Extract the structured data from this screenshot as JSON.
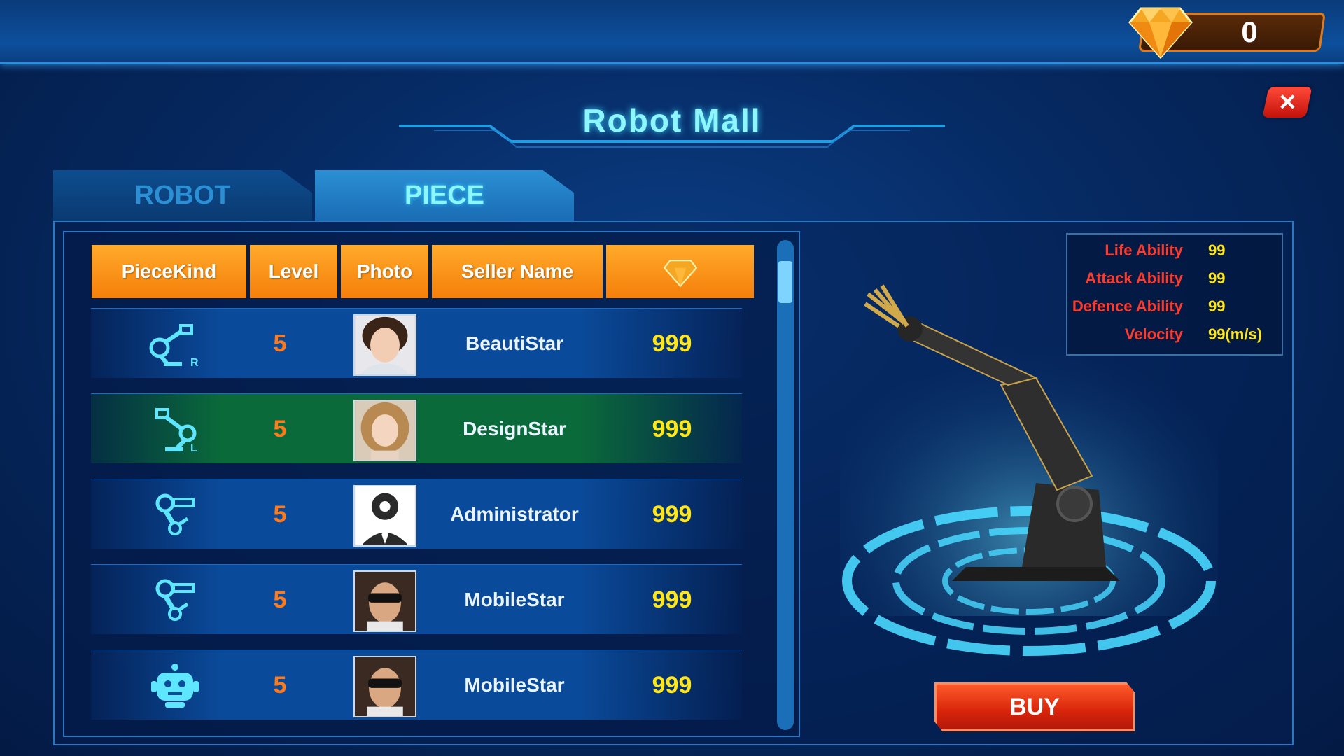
{
  "currency": {
    "count": "0",
    "icon": "diamond-icon",
    "color": "#f5a623"
  },
  "title": "Robot Mall",
  "close": {
    "label": "✕"
  },
  "tabs": [
    {
      "label": "ROBOT",
      "active": false
    },
    {
      "label": "PIECE",
      "active": true
    }
  ],
  "table": {
    "headers": {
      "kind": "PieceKind",
      "level": "Level",
      "photo": "Photo",
      "seller": "Seller Name",
      "price_icon": "diamond-icon"
    },
    "rows": [
      {
        "kind_icon": "robot-arm-right-icon",
        "level": "5",
        "photo": "female-avatar",
        "seller": "BeautiStar",
        "price": "999",
        "selected": false
      },
      {
        "kind_icon": "robot-arm-left-icon",
        "level": "5",
        "photo": "girl-avatar",
        "seller": "DesignStar",
        "price": "999",
        "selected": true
      },
      {
        "kind_icon": "robot-arm-gear-icon",
        "level": "5",
        "photo": "admin-gear-avatar",
        "seller": "Administrator",
        "price": "999",
        "selected": false
      },
      {
        "kind_icon": "robot-arm-gear-icon",
        "level": "5",
        "photo": "male-sunglasses-avatar",
        "seller": "MobileStar",
        "price": "999",
        "selected": false
      },
      {
        "kind_icon": "robot-head-icon",
        "level": "5",
        "photo": "male-sunglasses-avatar",
        "seller": "MobileStar",
        "price": "999",
        "selected": false
      }
    ]
  },
  "stats": [
    {
      "label": "Life Ability",
      "value": "99"
    },
    {
      "label": "Attack Ability",
      "value": "99"
    },
    {
      "label": "Defence Ability",
      "value": "99"
    },
    {
      "label": "Velocity",
      "value": "99(m/s)"
    }
  ],
  "buy_label": "BUY",
  "colors": {
    "accent": "#8ef6ff",
    "header": "#f57f0a",
    "price": "#ffe61a",
    "level": "#ff7a1a",
    "stat_label": "#ff3a2a",
    "selected_row": "#0a6a3a"
  }
}
